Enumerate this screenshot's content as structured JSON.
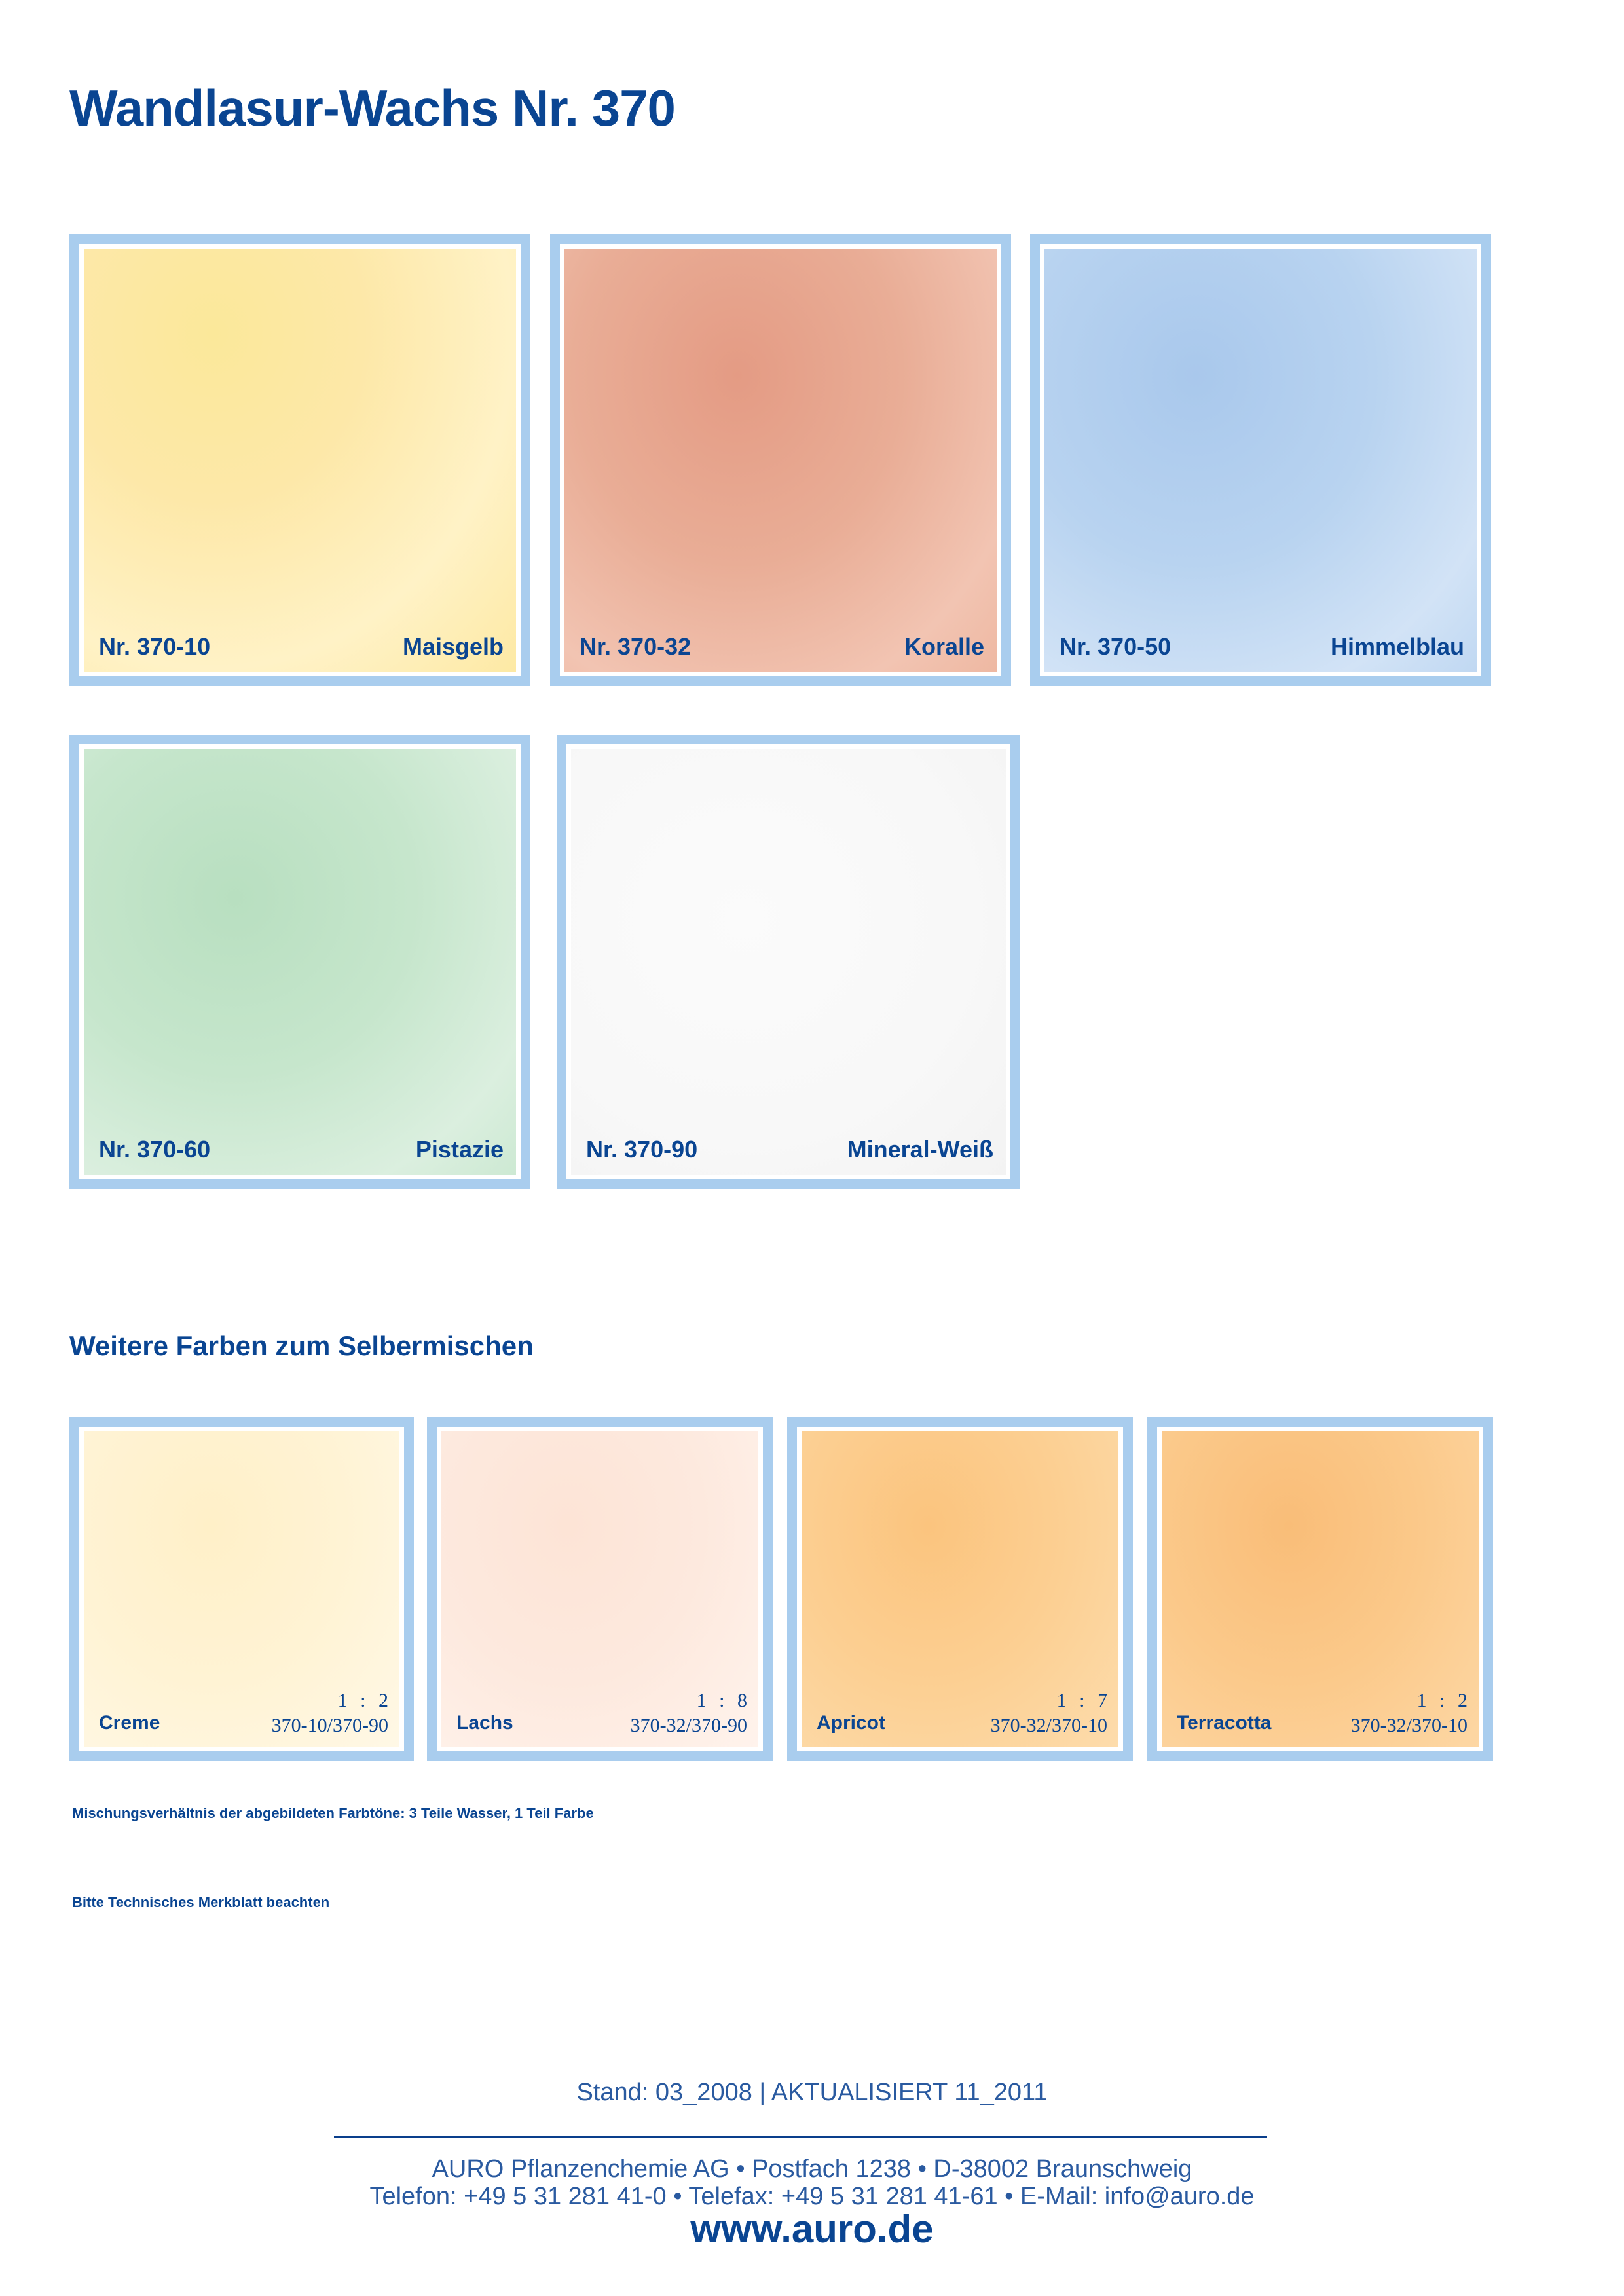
{
  "title": "Wandlasur-Wachs Nr. 370",
  "main_colors": [
    {
      "code": "Nr. 370-10",
      "name": "Maisgelb"
    },
    {
      "code": "Nr. 370-32",
      "name": "Koralle"
    },
    {
      "code": "Nr. 370-50",
      "name": "Himmelblau"
    },
    {
      "code": "Nr. 370-60",
      "name": "Pistazie"
    },
    {
      "code": "Nr. 370-90",
      "name": "Mineral-Weiß"
    }
  ],
  "mix_section": {
    "heading": "Weitere Farben zum Selbermischen",
    "items": [
      {
        "name": "Creme",
        "ratio": "1 : 2",
        "codes": "370-10/370-90"
      },
      {
        "name": "Lachs",
        "ratio": "1 : 8",
        "codes": "370-32/370-90"
      },
      {
        "name": "Apricot",
        "ratio": "1 : 7",
        "codes": "370-32/370-10"
      },
      {
        "name": "Terracotta",
        "ratio": "1 : 2",
        "codes": "370-32/370-10"
      }
    ]
  },
  "notes": {
    "mixing": "Mischungsverhältnis der abgebildeten Farbtöne: 3 Teile Wasser, 1 Teil Farbe",
    "merkblatt": "Bitte Technisches Merkblatt beachten"
  },
  "footer": {
    "stand": "Stand: 03_2008 | AKTUALISIERT 11_2011",
    "address": "AURO Pflanzenchemie AG • Postfach 1238 • D-38002 Braunschweig",
    "contact": "Telefon: +49 5 31 281 41-0 • Telefax: +49 5 31 281 41-61 • E-Mail: info@auro.de",
    "web": "www.auro.de"
  }
}
